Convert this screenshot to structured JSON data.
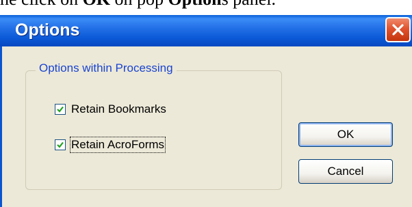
{
  "context": {
    "prefix": "he click on ",
    "ok_word": "OK",
    "middle": " on pop ",
    "options_word": "Option",
    "suffix": "s panel."
  },
  "window": {
    "title": "Options",
    "close_icon": "close-icon"
  },
  "group": {
    "label": "Options within Processing",
    "checkboxes": [
      {
        "label": "Retain Bookmarks",
        "checked": true
      },
      {
        "label": "Retain AcroForms",
        "checked": true
      }
    ]
  },
  "buttons": {
    "ok": "OK",
    "cancel": "Cancel"
  },
  "colors": {
    "titlebar": "#2471e8",
    "dialog_bg": "#ece9d8",
    "group_label": "#1a44d0",
    "close_button": "#e0532e",
    "check_mark": "#21a121"
  }
}
